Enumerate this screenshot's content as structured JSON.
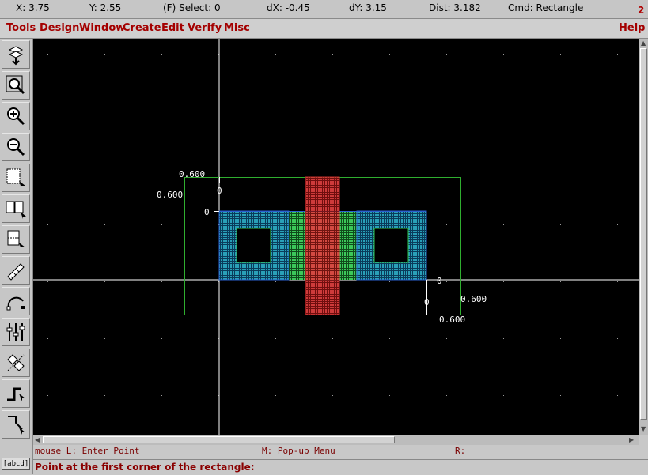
{
  "status": {
    "x": "X:  3.75",
    "y": "Y:  2.55",
    "select": "(F) Select: 0",
    "dx": "dX:  -0.45",
    "dy": "dY:  3.15",
    "dist": "Dist: 3.182",
    "cmd": "Cmd: Rectangle",
    "window_number": "2"
  },
  "menu": {
    "items": [
      "Tools",
      "Design",
      "Window",
      "Create",
      "Edit",
      "Verify",
      "Misc"
    ],
    "help": "Help"
  },
  "toolbar": {
    "icons": [
      "layer-select-icon",
      "zoom-fit-icon",
      "zoom-in-icon",
      "zoom-out-icon",
      "select-box-icon",
      "multi-select-icon",
      "partial-select-icon",
      "ruler-icon",
      "arc-icon",
      "align-icon",
      "transform-icon",
      "step-wire-icon",
      "polygon-icon"
    ],
    "label_tool": "[abcd]"
  },
  "layout": {
    "dimension_labels": {
      "top_width": "0.600",
      "left_height": "0.600",
      "top_zero": "0",
      "left_zero": "0",
      "right_zero": "0",
      "bottom_zero": "0",
      "right_height": "0.600",
      "bottom_width": "0.600"
    },
    "colors": {
      "canvas": "#000000",
      "boundary": "#2fae2f",
      "poly": "#d23030",
      "diffusion": "#2fbf4a",
      "metal": "#2a5fd0",
      "axes": "#ffffff"
    }
  },
  "hints": {
    "left": "mouse L: Enter Point",
    "middle": "M: Pop-up Menu",
    "right": "R:"
  },
  "prompt": "Point at the first corner of the rectangle:"
}
